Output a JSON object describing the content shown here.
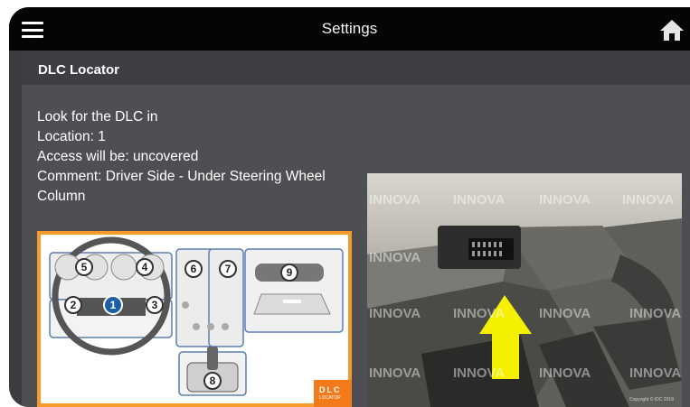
{
  "header": {
    "title": "Settings",
    "menu_icon": "hamburger-menu-icon",
    "home_icon": "home-icon"
  },
  "section": {
    "title": "DLC Locator"
  },
  "dlc_info": {
    "line1": "Look for the DLC in",
    "location": "Location: 1",
    "access": "Access will be: uncovered",
    "comment": "Comment: Driver Side - Under Steering Wheel Column"
  },
  "diagram": {
    "locations": [
      "1",
      "2",
      "3",
      "4",
      "5",
      "6",
      "7",
      "8",
      "9"
    ],
    "selected_location": "1",
    "badge_title": "DLC",
    "badge_sub": "LOCATOR"
  },
  "photo": {
    "watermark": "INNOVA",
    "copyright": "Copyright © IDC 2018"
  },
  "colors": {
    "topbar": "#050505",
    "background": "#4d4f52",
    "section_header": "#3c3e41",
    "diagram_border": "#f79a2b",
    "selected_marker": "#1c5ea8",
    "arrow": "#f4f000"
  }
}
